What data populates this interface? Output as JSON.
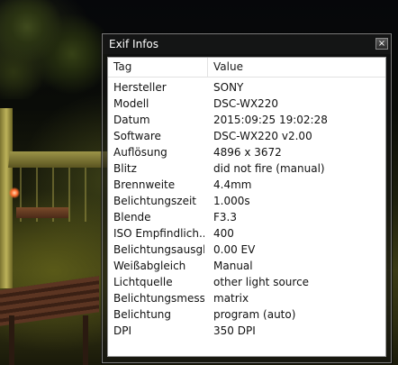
{
  "window": {
    "title": "Exif Infos",
    "close_glyph": "×"
  },
  "table": {
    "columns": [
      "Tag",
      "Value"
    ],
    "rows": [
      {
        "tag": "Hersteller",
        "value": "SONY"
      },
      {
        "tag": "Modell",
        "value": "DSC-WX220"
      },
      {
        "tag": "Datum",
        "value": "2015:09:25 19:02:28"
      },
      {
        "tag": "Software",
        "value": "DSC-WX220 v2.00"
      },
      {
        "tag": "Auflösung",
        "value": "4896 x 3672"
      },
      {
        "tag": "Blitz",
        "value": "did not fire (manual)"
      },
      {
        "tag": "Brennweite",
        "value": "4.4mm"
      },
      {
        "tag": "Belichtungszeit",
        "value": "1.000s"
      },
      {
        "tag": "Blende",
        "value": "F3.3"
      },
      {
        "tag": "ISO Empfindlich...",
        "value": "400"
      },
      {
        "tag": "Belichtungsausgl...",
        "value": "0.00 EV"
      },
      {
        "tag": "Weißabgleich",
        "value": "Manual"
      },
      {
        "tag": "Lichtquelle",
        "value": "other light source"
      },
      {
        "tag": "Belichtungsmess...",
        "value": "matrix"
      },
      {
        "tag": "Belichtung",
        "value": "program (auto)"
      },
      {
        "tag": "DPI",
        "value": "350 DPI"
      }
    ]
  }
}
